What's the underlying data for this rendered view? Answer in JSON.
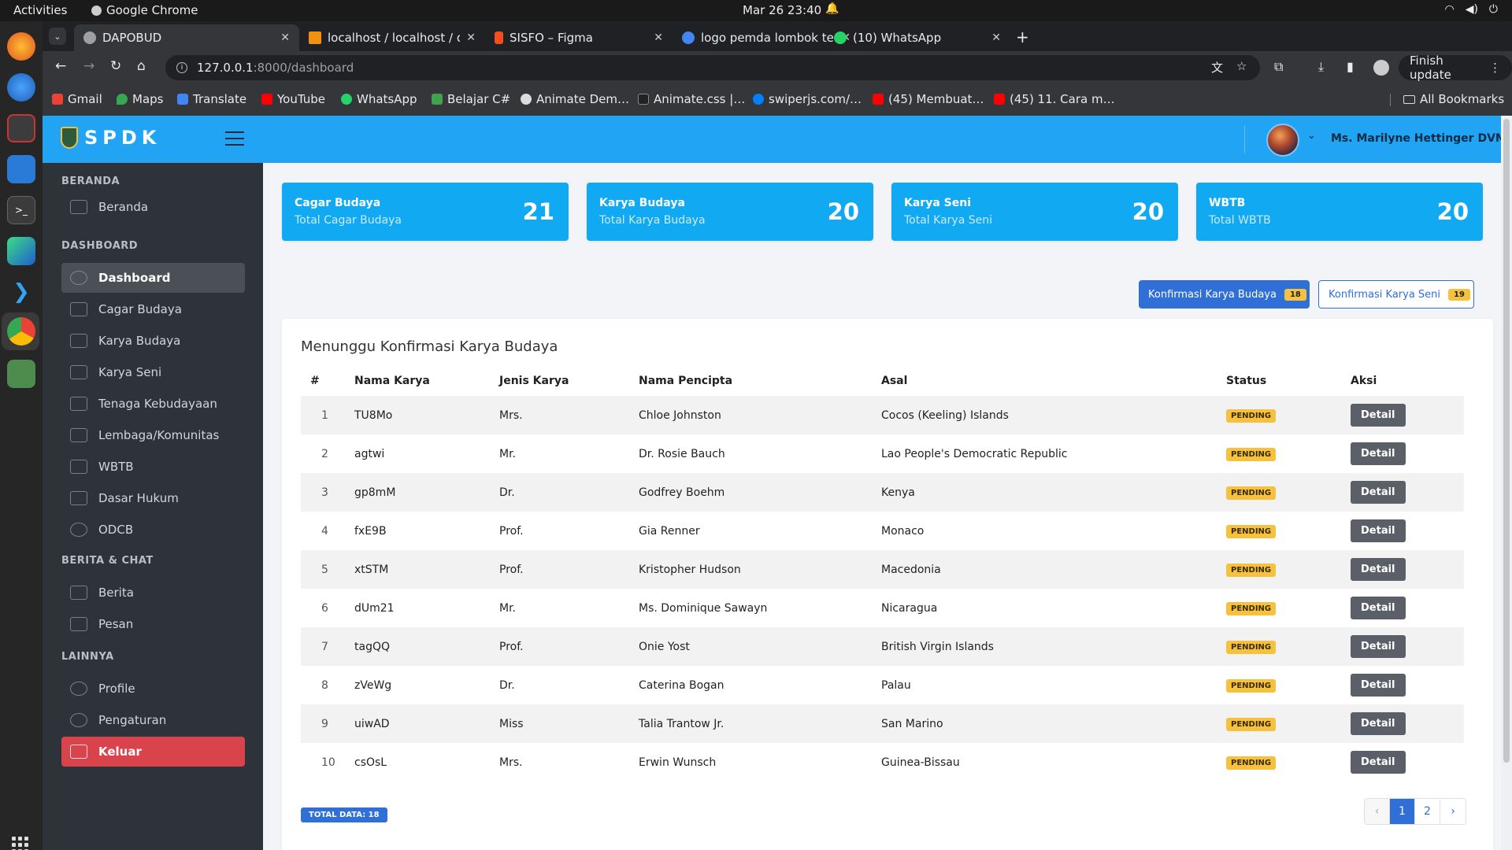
{
  "os": {
    "activities": "Activities",
    "app_name": "Google Chrome",
    "clock": "Mar 26  23:40"
  },
  "browser": {
    "tabs": [
      {
        "title": "DAPOBUD",
        "color": "#9aa0a6"
      },
      {
        "title": "localhost / localhost / da",
        "color": "#f29111"
      },
      {
        "title": "SISFO – Figma",
        "color": "#f24e1e"
      },
      {
        "title": "logo pemda lombok ten",
        "color": "#4285f4"
      },
      {
        "title": "(10) WhatsApp",
        "color": "#25d366"
      }
    ],
    "url_host": "127.0.0.1",
    "url_rest": ":8000/dashboard",
    "finish_update": "Finish update",
    "bookmarks": [
      {
        "label": "Gmail",
        "color": "#ea4335"
      },
      {
        "label": "Maps",
        "color": "#34a853"
      },
      {
        "label": "Translate",
        "color": "#4285f4"
      },
      {
        "label": "YouTube",
        "color": "#ff0000"
      },
      {
        "label": "WhatsApp",
        "color": "#25d366"
      },
      {
        "label": "Belajar C#",
        "color": "#3fa34d"
      },
      {
        "label": "Animate Dem…",
        "color": "#dddddd"
      },
      {
        "label": "Animate.css |…",
        "color": "#222222"
      },
      {
        "label": "swiperjs.com/…",
        "color": "#0080ff"
      },
      {
        "label": "(45) Membuat…",
        "color": "#ff0000"
      },
      {
        "label": "(45) 11. Cara m…",
        "color": "#ff0000"
      }
    ],
    "all_bookmarks": "All Bookmarks"
  },
  "app": {
    "brand": "SPDK",
    "user_name": "Ms. Marilyne Hettinger DVM",
    "sidebar": {
      "sections": [
        {
          "title": "BERANDA",
          "items": [
            {
              "label": "Beranda"
            }
          ]
        },
        {
          "title": "DASHBOARD",
          "items": [
            {
              "label": "Dashboard"
            },
            {
              "label": "Cagar Budaya"
            },
            {
              "label": "Karya Budaya"
            },
            {
              "label": "Karya Seni"
            },
            {
              "label": "Tenaga Kebudayaan"
            },
            {
              "label": "Lembaga/Komunitas"
            },
            {
              "label": "WBTB"
            },
            {
              "label": "Dasar Hukum"
            },
            {
              "label": "ODCB"
            }
          ]
        },
        {
          "title": "BERITA & CHAT",
          "items": [
            {
              "label": "Berita"
            },
            {
              "label": "Pesan"
            }
          ]
        },
        {
          "title": "LAINNYA",
          "items": [
            {
              "label": "Profile"
            },
            {
              "label": "Pengaturan"
            },
            {
              "label": "Keluar"
            }
          ]
        }
      ]
    },
    "stats": [
      {
        "title": "Cagar Budaya",
        "subtitle": "Total Cagar Budaya",
        "value": "21"
      },
      {
        "title": "Karya Budaya",
        "subtitle": "Total Karya Budaya",
        "value": "20"
      },
      {
        "title": "Karya Seni",
        "subtitle": "Total Karya Seni",
        "value": "20"
      },
      {
        "title": "WBTB",
        "subtitle": "Total WBTB",
        "value": "20"
      }
    ],
    "confirm_buttons": {
      "karya_budaya": {
        "label": "Konfirmasi Karya Budaya",
        "count": "18"
      },
      "karya_seni": {
        "label": "Konfirmasi Karya Seni",
        "count": "19"
      }
    },
    "table": {
      "title": "Menunggu Konfirmasi Karya Budaya",
      "headers": [
        "#",
        "Nama Karya",
        "Jenis Karya",
        "Nama Pencipta",
        "Asal",
        "Status",
        "Aksi"
      ],
      "rows": [
        {
          "no": "1",
          "nama": "TU8Mo",
          "jenis": "Mrs.",
          "pencipta": "Chloe Johnston",
          "asal": "Cocos (Keeling) Islands",
          "status": "PENDING",
          "aksi": "Detail"
        },
        {
          "no": "2",
          "nama": "agtwi",
          "jenis": "Mr.",
          "pencipta": "Dr. Rosie Bauch",
          "asal": "Lao People's Democratic Republic",
          "status": "PENDING",
          "aksi": "Detail"
        },
        {
          "no": "3",
          "nama": "gp8mM",
          "jenis": "Dr.",
          "pencipta": "Godfrey Boehm",
          "asal": "Kenya",
          "status": "PENDING",
          "aksi": "Detail"
        },
        {
          "no": "4",
          "nama": "fxE9B",
          "jenis": "Prof.",
          "pencipta": "Gia Renner",
          "asal": "Monaco",
          "status": "PENDING",
          "aksi": "Detail"
        },
        {
          "no": "5",
          "nama": "xtSTM",
          "jenis": "Prof.",
          "pencipta": "Kristopher Hudson",
          "asal": "Macedonia",
          "status": "PENDING",
          "aksi": "Detail"
        },
        {
          "no": "6",
          "nama": "dUm21",
          "jenis": "Mr.",
          "pencipta": "Ms. Dominique Sawayn",
          "asal": "Nicaragua",
          "status": "PENDING",
          "aksi": "Detail"
        },
        {
          "no": "7",
          "nama": "tagQQ",
          "jenis": "Prof.",
          "pencipta": "Onie Yost",
          "asal": "British Virgin Islands",
          "status": "PENDING",
          "aksi": "Detail"
        },
        {
          "no": "8",
          "nama": "zVeWg",
          "jenis": "Dr.",
          "pencipta": "Caterina Bogan",
          "asal": "Palau",
          "status": "PENDING",
          "aksi": "Detail"
        },
        {
          "no": "9",
          "nama": "uiwAD",
          "jenis": "Miss",
          "pencipta": "Talia Trantow Jr.",
          "asal": "San Marino",
          "status": "PENDING",
          "aksi": "Detail"
        },
        {
          "no": "10",
          "nama": "csOsL",
          "jenis": "Mrs.",
          "pencipta": "Erwin Wunsch",
          "asal": "Guinea-Bissau",
          "status": "PENDING",
          "aksi": "Detail"
        }
      ],
      "total_label": "TOTAL DATA: 18",
      "pagination": {
        "prev": "‹",
        "pages": [
          "1",
          "2"
        ],
        "current": "1",
        "next": "›"
      }
    }
  }
}
